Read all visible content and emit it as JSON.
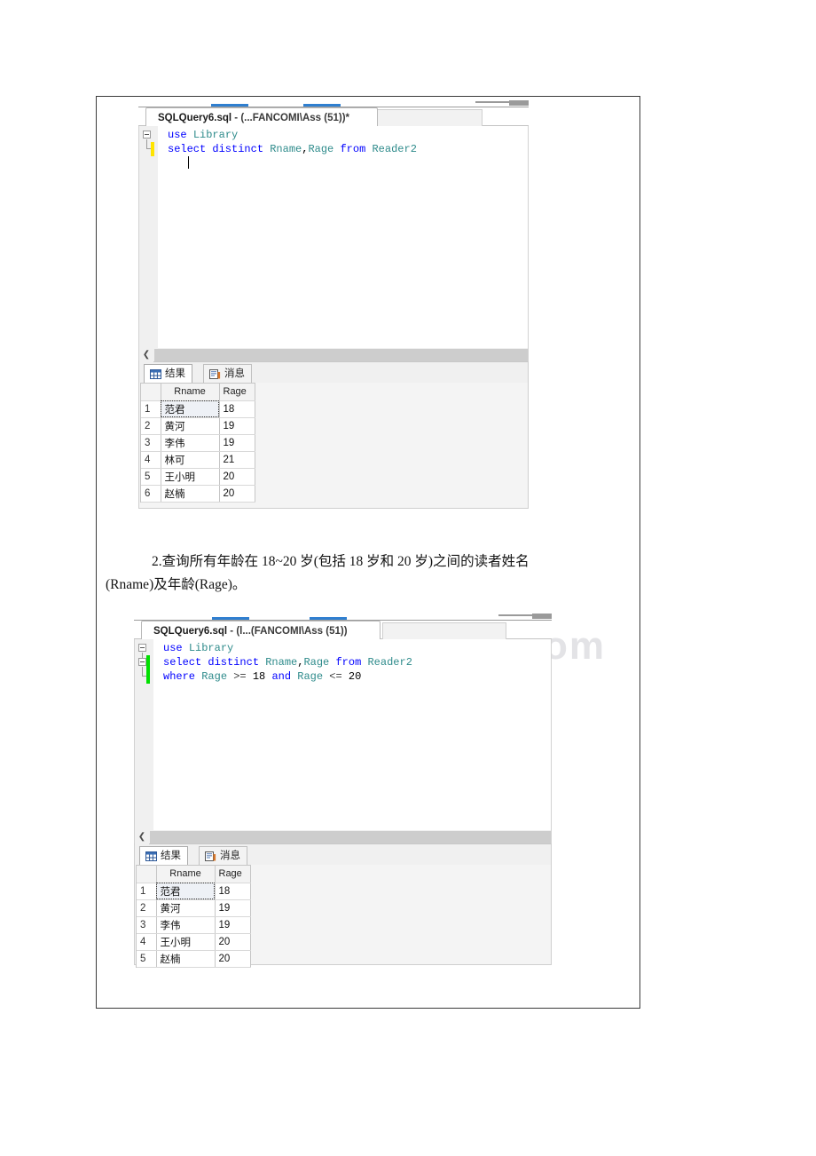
{
  "watermark": "www.bdoox.com",
  "blocks": [
    {
      "tab_title_bold": "SQLQuery6.sql",
      "tab_title_rest": " - (...FANCOMI\\Ass (51))*",
      "code_lines": [
        {
          "tokens": [
            {
              "t": "use",
              "c": "kw"
            },
            {
              "t": " ",
              "c": "plain"
            },
            {
              "t": "Library",
              "c": "id"
            }
          ]
        },
        {
          "tokens": [
            {
              "t": "select distinct",
              "c": "kw"
            },
            {
              "t": " ",
              "c": "plain"
            },
            {
              "t": "Rname",
              "c": "id"
            },
            {
              "t": ",",
              "c": "plain"
            },
            {
              "t": "Rage",
              "c": "id"
            },
            {
              "t": " ",
              "c": "plain"
            },
            {
              "t": "from",
              "c": "kw"
            },
            {
              "t": " ",
              "c": "plain"
            },
            {
              "t": "Reader2",
              "c": "id"
            }
          ]
        },
        {
          "tokens": []
        }
      ],
      "change_bar_color": "yellow",
      "results": {
        "tab_results": "结果",
        "tab_messages": "消息",
        "columns": [
          "Rname",
          "Rage"
        ],
        "rows": [
          {
            "n": "1",
            "Rname": "范君",
            "Rage": "18"
          },
          {
            "n": "2",
            "Rname": "黄河",
            "Rage": "19"
          },
          {
            "n": "3",
            "Rname": "李伟",
            "Rage": "19"
          },
          {
            "n": "4",
            "Rname": "林可",
            "Rage": "21"
          },
          {
            "n": "5",
            "Rname": "王小明",
            "Rage": "20"
          },
          {
            "n": "6",
            "Rname": "赵楠",
            "Rage": "20"
          }
        ]
      }
    },
    {
      "tab_title_bold": "SQLQuery6.sql",
      "tab_title_rest": " - (l...(FANCOMI\\Ass (51))",
      "code_lines": [
        {
          "tokens": [
            {
              "t": "use",
              "c": "kw"
            },
            {
              "t": " ",
              "c": "plain"
            },
            {
              "t": "Library",
              "c": "id"
            }
          ]
        },
        {
          "tokens": [
            {
              "t": "select distinct",
              "c": "kw"
            },
            {
              "t": " ",
              "c": "plain"
            },
            {
              "t": "Rname",
              "c": "id"
            },
            {
              "t": ",",
              "c": "plain"
            },
            {
              "t": "Rage",
              "c": "id"
            },
            {
              "t": " ",
              "c": "plain"
            },
            {
              "t": "from",
              "c": "kw"
            },
            {
              "t": " ",
              "c": "plain"
            },
            {
              "t": "Reader2",
              "c": "id"
            }
          ]
        },
        {
          "tokens": [
            {
              "t": "where",
              "c": "kw"
            },
            {
              "t": " ",
              "c": "plain"
            },
            {
              "t": "Rage",
              "c": "id"
            },
            {
              "t": " ",
              "c": "plain"
            },
            {
              "t": ">=",
              "c": "op"
            },
            {
              "t": " ",
              "c": "plain"
            },
            {
              "t": "18",
              "c": "num"
            },
            {
              "t": " ",
              "c": "plain"
            },
            {
              "t": "and",
              "c": "kw"
            },
            {
              "t": " ",
              "c": "plain"
            },
            {
              "t": "Rage",
              "c": "id"
            },
            {
              "t": " ",
              "c": "plain"
            },
            {
              "t": "<=",
              "c": "op"
            },
            {
              "t": " ",
              "c": "plain"
            },
            {
              "t": "20",
              "c": "num"
            }
          ]
        }
      ],
      "change_bar_color": "green",
      "results": {
        "tab_results": "结果",
        "tab_messages": "消息",
        "columns": [
          "Rname",
          "Rage"
        ],
        "rows": [
          {
            "n": "1",
            "Rname": "范君",
            "Rage": "18"
          },
          {
            "n": "2",
            "Rname": "黄河",
            "Rage": "19"
          },
          {
            "n": "3",
            "Rname": "李伟",
            "Rage": "19"
          },
          {
            "n": "4",
            "Rname": "王小明",
            "Rage": "20"
          },
          {
            "n": "5",
            "Rname": "赵楠",
            "Rage": "20"
          }
        ]
      }
    }
  ],
  "paragraph": {
    "line1": "2.查询所有年龄在 18~20 岁(包括 18 岁和 20 岁)之间的读者姓名",
    "line2": "(Rname)及年龄(Rage)。"
  }
}
